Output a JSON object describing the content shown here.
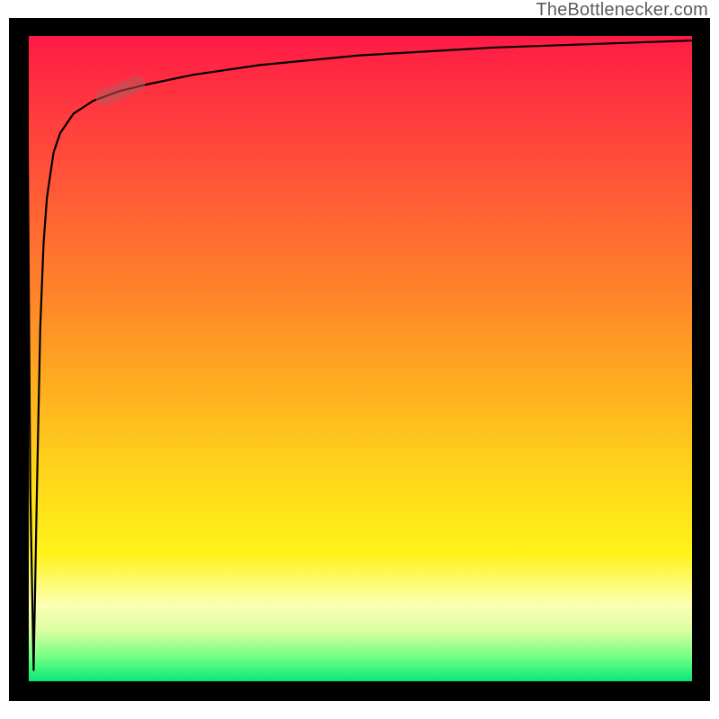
{
  "watermark": {
    "text": "TheBottlenecker.com"
  },
  "chart_data": {
    "type": "line",
    "title": "",
    "xlabel": "",
    "ylabel": "",
    "xlim": [
      0,
      100
    ],
    "ylim": [
      0,
      100
    ],
    "grid": false,
    "background_gradient": {
      "direction": "vertical",
      "stops": [
        {
          "position": 0.0,
          "value": 100,
          "color": "#ff1a46"
        },
        {
          "position": 0.5,
          "value": 50,
          "color": "#ffb020"
        },
        {
          "position": 0.88,
          "value": 12,
          "color": "#fbffb5"
        },
        {
          "position": 1.0,
          "value": 0,
          "color": "#00e676"
        }
      ]
    },
    "series": [
      {
        "name": "curve",
        "x": [
          0,
          0.5,
          1,
          1.5,
          2,
          2.5,
          3,
          4,
          5,
          7,
          10,
          14,
          18,
          25,
          35,
          50,
          70,
          100
        ],
        "y": [
          100,
          30,
          2,
          30,
          55,
          68,
          75,
          82,
          85,
          88,
          90,
          91.5,
          92.5,
          94,
          95.5,
          97,
          98.2,
          99.3
        ]
      }
    ],
    "annotations": [
      {
        "name": "highlight-marker",
        "shape": "pill",
        "x": 14,
        "y": 91.5,
        "rotation_deg": -22,
        "color": "rgba(180,90,90,0.55)"
      }
    ]
  }
}
